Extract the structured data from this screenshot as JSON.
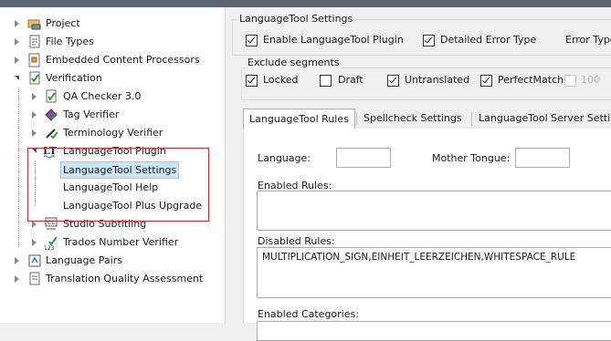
{
  "tree": {
    "items": [
      {
        "label": "Project",
        "icon": "project-icon"
      },
      {
        "label": "File Types",
        "icon": "file-types-icon"
      },
      {
        "label": "Embedded Content Processors",
        "icon": "embedded-content-icon"
      },
      {
        "label": "Verification",
        "icon": "verification-icon"
      },
      {
        "label": "QA Checker 3.0",
        "icon": "qa-checker-icon"
      },
      {
        "label": "Tag Verifier",
        "icon": "tag-verifier-icon"
      },
      {
        "label": "Terminology Verifier",
        "icon": "terminology-verifier-icon"
      },
      {
        "label": "LanguageTool Plugin",
        "icon": "languagetool-lt-icon"
      },
      {
        "label": "LanguageTool Settings"
      },
      {
        "label": "LanguageTool Help"
      },
      {
        "label": "LanguageTool Plus Upgrade"
      },
      {
        "label": "Studio Subtitling",
        "icon": "subtitling-cc-icon"
      },
      {
        "label": "Trados Number Verifier",
        "icon": "number-verifier-icon"
      },
      {
        "label": "Language Pairs",
        "icon": "language-pairs-icon"
      },
      {
        "label": "Translation Quality Assessment",
        "icon": "tqa-icon"
      }
    ],
    "selected": "LanguageTool Settings"
  },
  "settings": {
    "group_title": "LanguageTool Settings",
    "enable_label": "Enable LanguageTool Plugin",
    "enable_checked": true,
    "detailed_label": "Detailed Error Type",
    "detailed_checked": true,
    "error_type_label": "Error Type"
  },
  "exclude": {
    "title": "Exclude segments",
    "locked": "Locked",
    "locked_checked": true,
    "draft": "Draft",
    "draft_checked": false,
    "untranslated": "Untranslated",
    "untranslated_checked": true,
    "perfectmatch": "PerfectMatch",
    "perfectmatch_checked": true,
    "partial": "100"
  },
  "tabs": [
    "LanguageTool Rules",
    "Spellcheck Settings",
    "LanguageTool Server Settings"
  ],
  "rules": {
    "language_label": "Language:",
    "language_value": "",
    "mother_tongue_label": "Mother Tongue:",
    "mother_tongue_value": "",
    "enabled_rules_label": "Enabled Rules:",
    "enabled_rules_value": "",
    "disabled_rules_label": "Disabled Rules:",
    "disabled_rules_value": "MULTIPLICATION_SIGN,EINHEIT_LEERZEICHEN,WHITESPACE_RULE",
    "enabled_categories_label": "Enabled Categories:"
  }
}
